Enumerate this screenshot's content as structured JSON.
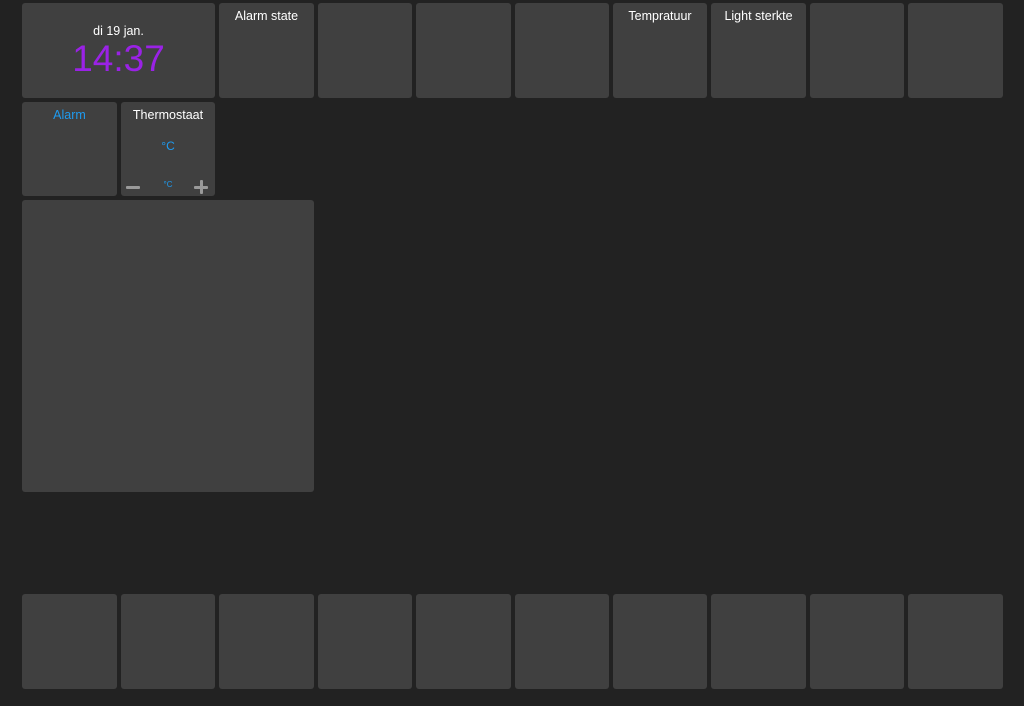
{
  "colors": {
    "background": "#222222",
    "tile": "#404040",
    "text": "#ffffff",
    "clock_time": "#9a22e6",
    "accent_blue": "#1e9bf0",
    "control_grey": "#9a9a9a"
  },
  "clock": {
    "date": "di 19 jan.",
    "time": "14:37"
  },
  "tiles": {
    "alarm_state": {
      "title": "Alarm state"
    },
    "temperatuur": {
      "title": "Tempratuur"
    },
    "light": {
      "title": "Light sterkte"
    },
    "alarm": {
      "title": "Alarm"
    }
  },
  "thermostat": {
    "title": "Thermostaat",
    "current_unit": "°C",
    "setpoint_unit": "°C",
    "minus_icon": "minus-icon",
    "plus_icon": "plus-icon"
  }
}
